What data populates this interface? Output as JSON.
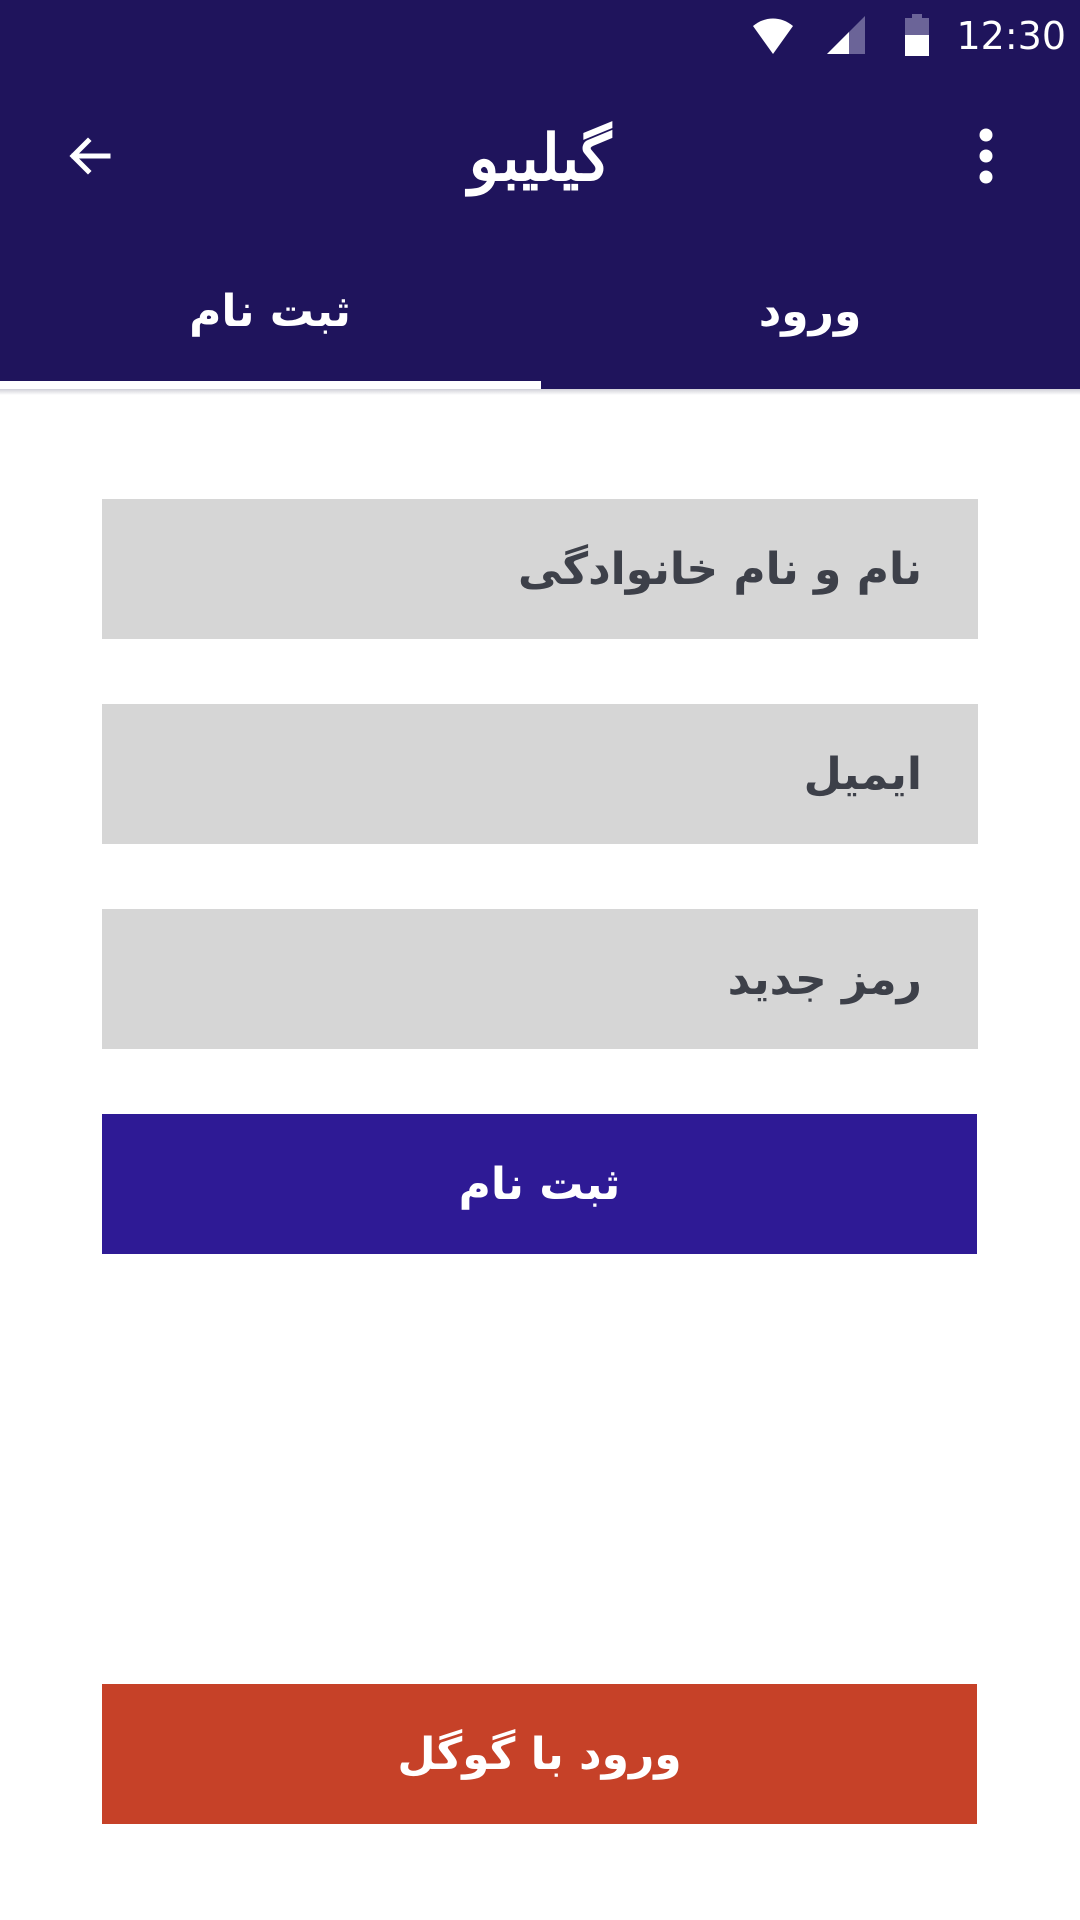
{
  "status_bar": {
    "time": "12:30",
    "icons": [
      "wifi-icon",
      "cell-signal-icon",
      "battery-icon"
    ]
  },
  "toolbar": {
    "title": "گیلیبو",
    "back_icon": "arrow-back-icon",
    "menu_icon": "more-vertical-icon"
  },
  "tabs": [
    {
      "label": "ثبت نام",
      "selected": true
    },
    {
      "label": "ورود",
      "selected": false
    }
  ],
  "form": {
    "name_placeholder": "نام و نام خانوادگی",
    "email_placeholder": "ایمیل",
    "password_placeholder": "رمز جدید",
    "submit_label": "ثبت نام",
    "google_label": "ورود با گوگل"
  },
  "colors": {
    "header_bg": "#1f145c",
    "field_bg": "#d6d6d6",
    "primary_button": "#2e1a95",
    "google_button": "#c64128"
  }
}
